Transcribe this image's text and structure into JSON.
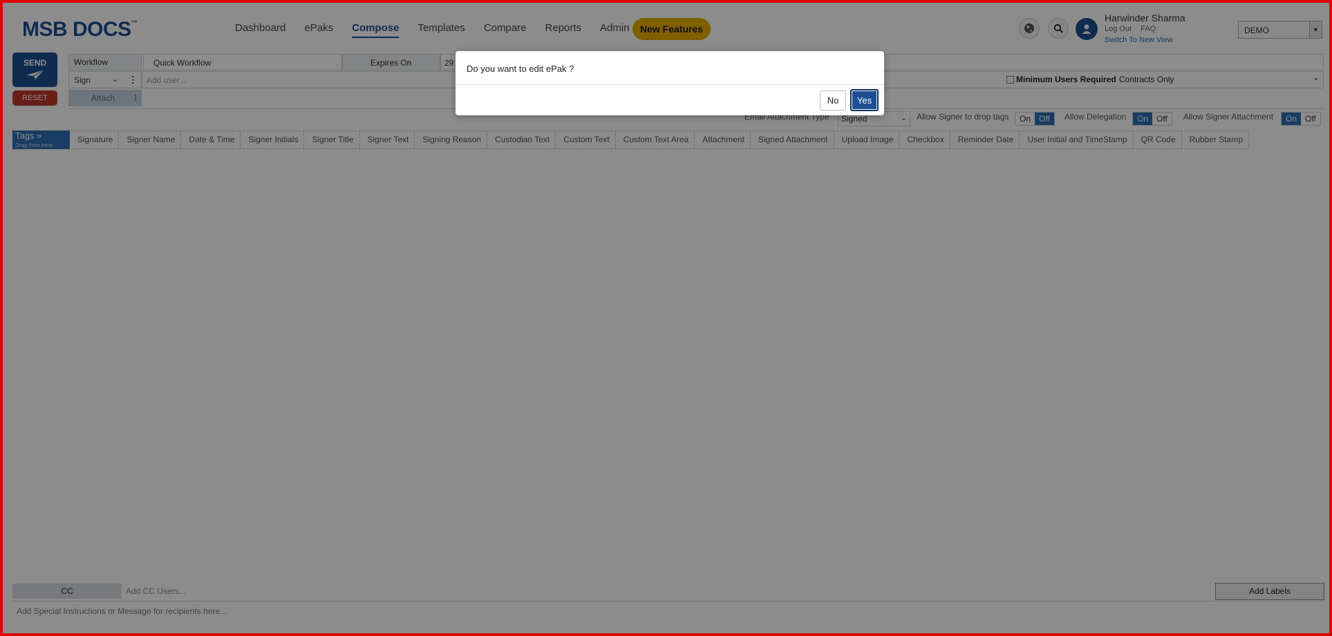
{
  "header": {
    "logo": "MSB DOCS",
    "logo_tm": "™",
    "nav": [
      {
        "label": "Dashboard"
      },
      {
        "label": "ePaks"
      },
      {
        "label": "Compose"
      },
      {
        "label": "Templates"
      },
      {
        "label": "Compare"
      },
      {
        "label": "Reports"
      },
      {
        "label": "Admin"
      }
    ],
    "active_nav": "Compose",
    "new_features": "New Features",
    "user_name": "Harwinder Sharma",
    "logout": "Log Out",
    "faq": "FAQ",
    "switch_view": "Switch To New View",
    "org": "DEMO"
  },
  "compose": {
    "send": "SEND",
    "reset": "RESET",
    "workflow_label": "Workflow",
    "workflow_value": "Quick Workflow",
    "expires_label": "Expires On",
    "expires_value": "29",
    "sign_select": "Sign",
    "add_user_placeholder": "Add user...",
    "attach": "Attach",
    "min_users": "Minimum Users Required",
    "contracts": "Contracts Only",
    "email_attachment_label": "Email Attachment Type",
    "email_attachment_value": "Signed",
    "allow_drop_tags": "Allow Signer to drop tags",
    "allow_delegation": "Allow Delegation",
    "allow_signer_attachment": "Allow Signer Attachment",
    "on": "On",
    "off": "Off"
  },
  "tags": {
    "label": "Tags »",
    "hint": "Drag from here",
    "items": [
      "Signature",
      "Signer Name",
      "Date & Time",
      "Signer Initials",
      "Signer Title",
      "Signer Text",
      "Signing Reason",
      "Custodian Text",
      "Custom Text",
      "Custom Text Area",
      "Attachment",
      "Signed Attachment",
      "Upload Image",
      "Checkbox",
      "Reminder Date",
      "User Initial and TimeStamp",
      "QR Code",
      "Rubber Stamp"
    ]
  },
  "footer": {
    "cc": "CC",
    "cc_placeholder": "Add CC Users...",
    "add_labels": "Add Labels",
    "instructions_placeholder": "Add Special Instructions or Message for recipients here..."
  },
  "modal": {
    "message": "Do you want to edit ePak ?",
    "no": "No",
    "yes": "Yes"
  },
  "colors": {
    "brand": "#1d4f91",
    "accent": "#e8b000",
    "reset": "#c0392b",
    "border": "#e00000"
  }
}
